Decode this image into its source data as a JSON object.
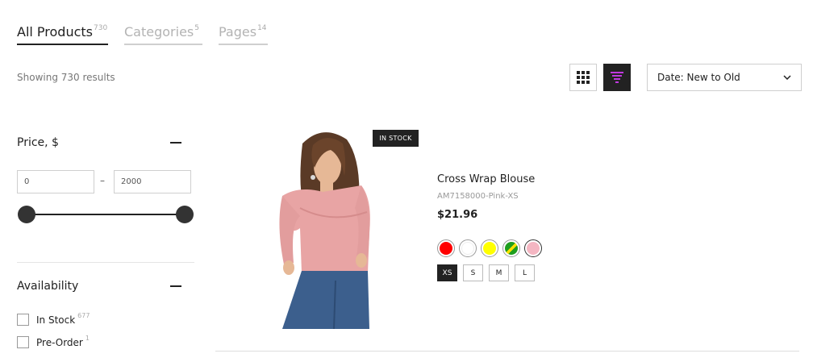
{
  "tabs": [
    {
      "label": "All Products",
      "count": "730"
    },
    {
      "label": "Categories",
      "count": "5"
    },
    {
      "label": "Pages",
      "count": "14"
    }
  ],
  "results_text": "Showing 730 results",
  "sort": {
    "selected": "Date: New to Old"
  },
  "filters": {
    "price": {
      "title": "Price, $",
      "min": "0",
      "max": "2000"
    },
    "availability": {
      "title": "Availability",
      "items": [
        {
          "label": "In Stock",
          "count": "677"
        },
        {
          "label": "Pre-Order",
          "count": "1"
        }
      ]
    }
  },
  "product": {
    "badge": "IN STOCK",
    "name": "Cross Wrap Blouse",
    "sku": "AM7158000-Pink-XS",
    "price": "$21.96",
    "colors": [
      "#ff0000",
      "#ffffff",
      "#ffff00",
      "green-yellow",
      "#f4b6c2"
    ],
    "selected_color": "#f4b6c2",
    "sizes": [
      "XS",
      "S",
      "M",
      "L"
    ],
    "selected_size": "XS"
  },
  "icons": {
    "grid_view": "grid-icon",
    "list_view": "list-icon",
    "sort_dropdown": "chevron-down-icon",
    "accent": "#c039e0"
  }
}
